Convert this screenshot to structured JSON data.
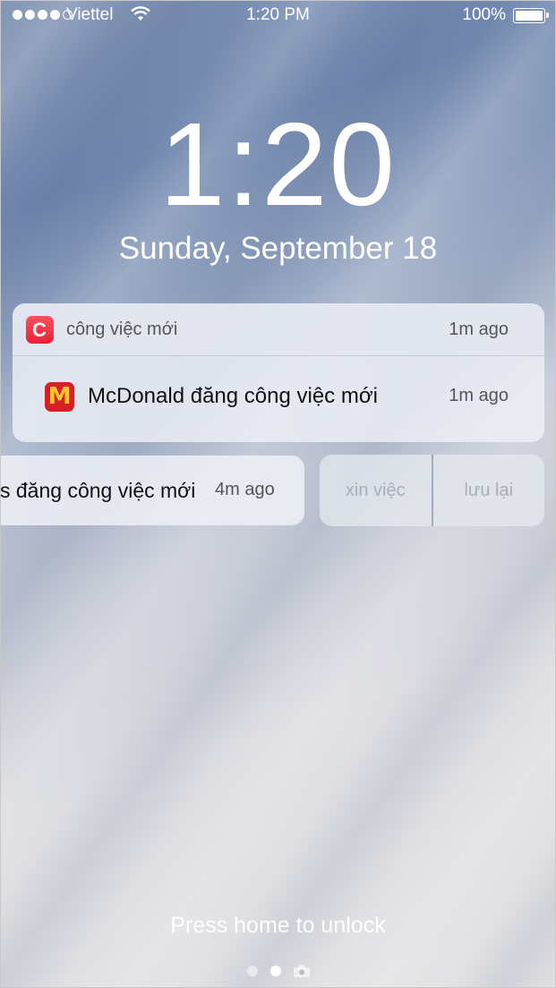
{
  "status_bar": {
    "carrier": "Viettel",
    "time": "1:20 PM",
    "battery_percent": "100%",
    "signal_bars_filled": 4,
    "signal_bars_total": 5
  },
  "lock_screen": {
    "time": "1:20",
    "date": "Sunday, September 18",
    "unlock_hint": "Press home to unlock",
    "page_count": 2,
    "active_page": 1
  },
  "notification_group": {
    "app_icon": "c-app-icon",
    "title": "công việc mới",
    "time": "1m ago",
    "items": [
      {
        "icon": "mcdonalds-icon",
        "text": "McDonald đăng công việc mới",
        "time": "1m ago"
      }
    ]
  },
  "swiped_notification": {
    "text": "s đăng công việc mới",
    "time": "4m ago",
    "actions": [
      "xin việc",
      "lưu lại"
    ]
  },
  "colors": {
    "app_icon_red": "#e8233a",
    "mcd_red": "#d81f26",
    "mcd_yellow": "#ffc72c"
  }
}
